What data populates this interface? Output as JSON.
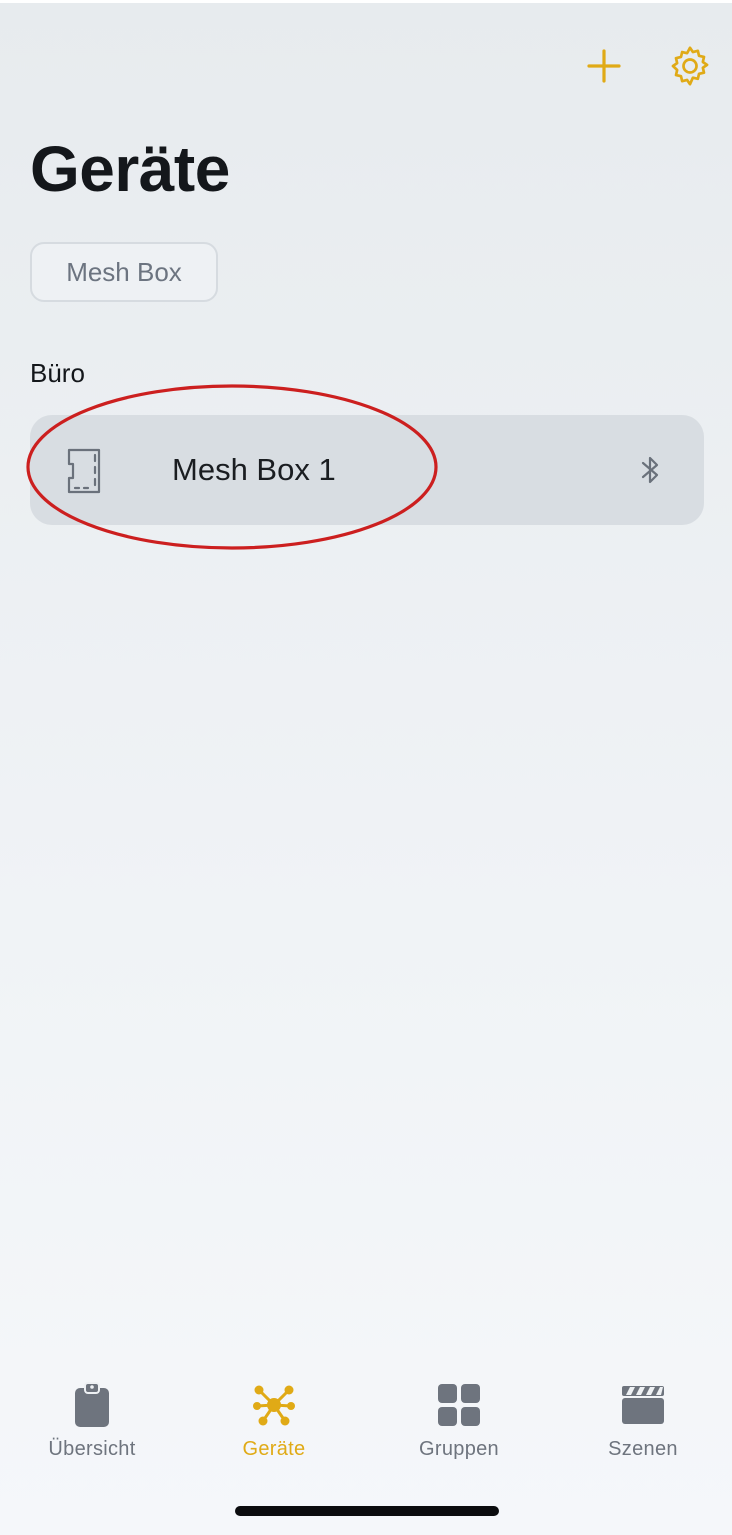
{
  "header": {
    "title": "Geräte",
    "add_icon": "plus-icon",
    "settings_icon": "gear-icon"
  },
  "filter": {
    "chip_label": "Mesh Box"
  },
  "section": {
    "label": "Büro"
  },
  "devices": [
    {
      "name": "Mesh Box 1",
      "icon": "device-board-icon",
      "status_icon": "bluetooth-icon"
    }
  ],
  "tabs": [
    {
      "label": "Übersicht",
      "icon": "clipboard-icon",
      "active": false
    },
    {
      "label": "Geräte",
      "icon": "network-nodes-icon",
      "active": true
    },
    {
      "label": "Gruppen",
      "icon": "grid-icon",
      "active": false
    },
    {
      "label": "Szenen",
      "icon": "clapperboard-icon",
      "active": false
    }
  ],
  "colors": {
    "accent": "#e0aa16",
    "inactive_tab": "#6e747e",
    "annotation": "#cc1f1f",
    "card": "#d8dde2"
  }
}
